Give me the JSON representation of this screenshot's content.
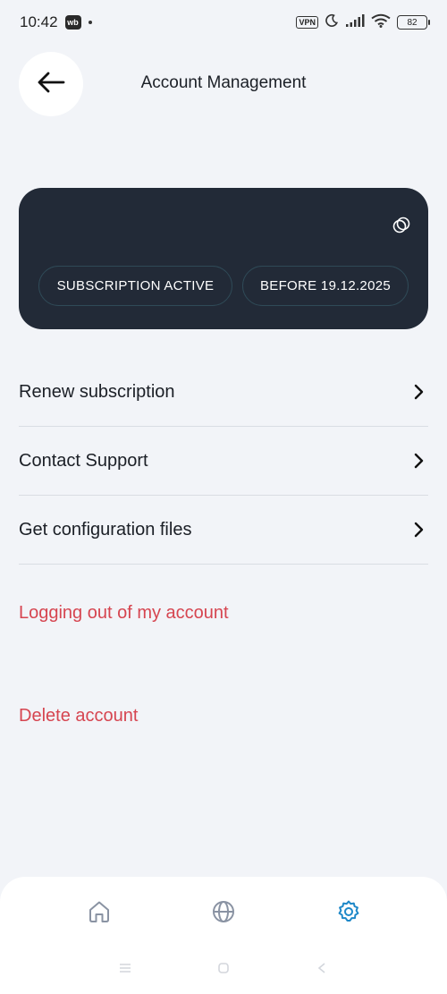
{
  "status_bar": {
    "time": "10:42",
    "app_badge": "wb",
    "vpn": "VPN",
    "battery": "82"
  },
  "header": {
    "title": "Account Management",
    "back_icon": "arrow-left-icon"
  },
  "subscription_card": {
    "status_label": "SUBSCRIPTION ACTIVE",
    "expiry_label": "BEFORE 19.12.2025",
    "icon": "copy-icon",
    "background_color": "#222a37",
    "pill_border_color": "#2f4a57"
  },
  "menu": {
    "items": [
      {
        "label": "Renew subscription",
        "icon": "chevron-right-icon"
      },
      {
        "label": "Contact Support",
        "icon": "chevron-right-icon"
      },
      {
        "label": "Get configuration files",
        "icon": "chevron-right-icon"
      }
    ]
  },
  "account_actions": {
    "logout_label": "Logging out of my account",
    "delete_label": "Delete account",
    "danger_color": "#d64550"
  },
  "bottom_nav": {
    "items": [
      {
        "icon": "home-icon",
        "active": false
      },
      {
        "icon": "globe-icon",
        "active": false
      },
      {
        "icon": "gear-icon",
        "active": true
      }
    ],
    "active_color": "#1e88c8"
  }
}
